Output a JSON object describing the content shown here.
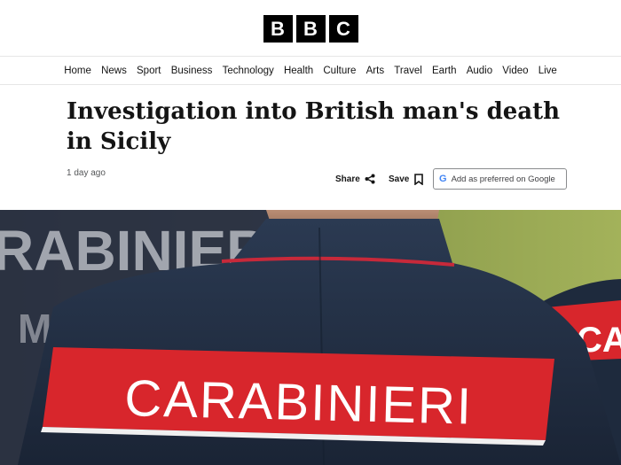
{
  "brand": {
    "letters": [
      "B",
      "B",
      "C"
    ]
  },
  "nav": {
    "items": [
      "Home",
      "News",
      "Sport",
      "Business",
      "Technology",
      "Health",
      "Culture",
      "Arts",
      "Travel",
      "Earth",
      "Audio",
      "Video",
      "Live"
    ]
  },
  "article": {
    "headline": "Investigation into British man's death in Sicily",
    "timestamp": "1 day ago",
    "share_label": "Share",
    "save_label": "Save",
    "google_label": "Add as preferred on Google"
  },
  "hero": {
    "main_patch_text": "CARABINIERI",
    "background_text_left": "RABINIER",
    "background_text_left_sub": "M",
    "background_text_right": "CA"
  },
  "colors": {
    "patch_red": "#d8262c",
    "jacket_navy": "#1d2a3e",
    "grass_green": "#93a74a"
  },
  "icons": [
    "share-icon",
    "bookmark-icon",
    "google-g-icon"
  ]
}
